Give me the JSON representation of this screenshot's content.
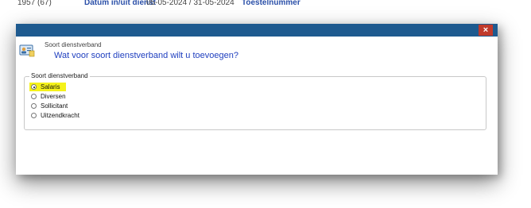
{
  "background": {
    "left_number": "1957 (67)",
    "label_datum": "Datum in/uit dienst",
    "dates": "05-05-2024  /  31-05-2024",
    "label_toestel": "Toestelnummer"
  },
  "dialog": {
    "close_label": "×",
    "subtitle": "Soort dienstverband",
    "question": "Wat voor soort dienstverband wilt u toevoegen?",
    "titlebar_color": "#1e5a8f",
    "question_color": "#1f3fbf"
  },
  "group": {
    "legend": "Soort dienstverband",
    "options": [
      {
        "label": "Salaris",
        "selected": true
      },
      {
        "label": "Diversen",
        "selected": false
      },
      {
        "label": "Sollicitant",
        "selected": false
      },
      {
        "label": "Uitzendkracht",
        "selected": false
      }
    ],
    "highlight_color": "#f5f21a"
  }
}
